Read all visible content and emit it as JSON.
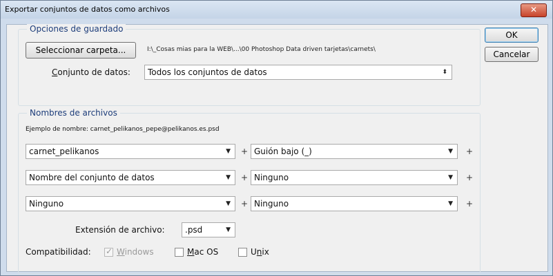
{
  "window": {
    "title": "Exportar conjuntos de datos como archivos",
    "close_label": "✕"
  },
  "buttons": {
    "ok": "OK",
    "cancel": "Cancelar"
  },
  "save_options": {
    "legend": "Opciones de guardado",
    "select_folder": "Seleccionar carpeta...",
    "folder_path": "I:\\_Cosas mias para la WEB\\...\\00 Photoshop Data driven tarjetas\\carnets\\",
    "dataset_label_pre": "C",
    "dataset_label_post": "onjunto de datos:",
    "dataset_value": "Todos los conjuntos de datos"
  },
  "file_names": {
    "legend": "Nombres de archivos",
    "example": "Ejemplo de nombre:  carnet_pelikanos_pepe@pelikanos.es.psd",
    "rows": [
      {
        "left": "carnet_pelikanos",
        "right": "Guión bajo (_)"
      },
      {
        "left": "Nombre del conjunto de datos",
        "right": "Ninguno"
      },
      {
        "left": "Ninguno",
        "right": "Ninguno"
      }
    ],
    "extension_label": "Extensión de archivo:",
    "extension_value": ".psd",
    "compat_label": "Compatibilidad:",
    "windows_pre": "W",
    "windows_post": "indows",
    "mac_pre": "M",
    "mac_post": "ac OS",
    "unix_pre": "U",
    "unix_mid": "n",
    "unix_post": "ix",
    "windows_checked": true,
    "mac_checked": false,
    "unix_checked": false
  }
}
